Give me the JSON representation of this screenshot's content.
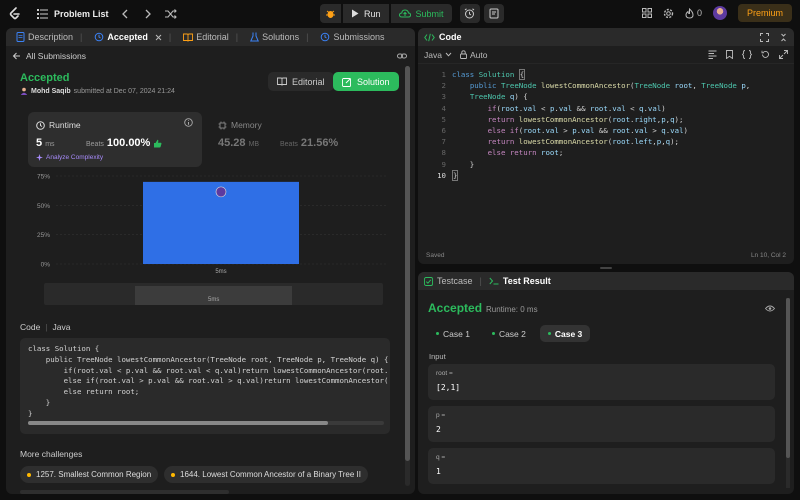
{
  "topbar": {
    "problem_list": "Problem List",
    "run": "Run",
    "submit": "Submit",
    "streak_count": "0",
    "premium": "Premium"
  },
  "left": {
    "tabs": [
      {
        "label": "Description"
      },
      {
        "label": "Accepted"
      },
      {
        "label": "Editorial"
      },
      {
        "label": "Solutions"
      },
      {
        "label": "Submissions"
      }
    ],
    "back_label": "All Submissions",
    "status": "Accepted",
    "author": "Mohd Saqib",
    "submitted_text": "submitted at Dec 07, 2024 21:24",
    "editorial_btn": "Editorial",
    "solution_btn": "Solution",
    "runtime": {
      "label": "Runtime",
      "value": "5",
      "unit": "ms",
      "beats_label": "Beats",
      "beats_value": "100.00%",
      "analyze": "Analyze Complexity"
    },
    "memory": {
      "label": "Memory",
      "value": "45.28",
      "unit": "MB",
      "beats_label": "Beats",
      "beats_value": "21.56%"
    },
    "code_label": "Code",
    "code_lang": "Java",
    "code_snippet": "class Solution {\n    public TreeNode lowestCommonAncestor(TreeNode root, TreeNode p, TreeNode q) {\n        if(root.val < p.val && root.val < q.val)return lowestCommonAncestor(root.\n        else if(root.val > p.val && root.val > q.val)return lowestCommonAncestor(\n        else return root;\n    }\n}",
    "more_title": "More challenges",
    "challenges": [
      {
        "label": "1257. Smallest Common Region"
      },
      {
        "label": "1644. Lowest Common Ancestor of a Binary Tree II"
      }
    ]
  },
  "chart_data": {
    "type": "bar",
    "categories": [
      "5ms"
    ],
    "values": [
      70
    ],
    "yticks": [
      "75%",
      "50%",
      "25%",
      "0%"
    ],
    "ylim": [
      0,
      75
    ],
    "bar_color": "#2f6fe6",
    "grid": true
  },
  "code_panel": {
    "title": "Code",
    "language": "Java",
    "mode": "Auto",
    "saved": "Saved",
    "cursor": "Ln 10, Col 2",
    "line_numbers": [
      "1",
      "2",
      "3",
      "4",
      "5",
      "6",
      "7",
      "8",
      "9",
      "10"
    ]
  },
  "test_panel": {
    "tab_testcase": "Testcase",
    "tab_result": "Test Result",
    "status": "Accepted",
    "runtime": "Runtime: 0 ms",
    "cases": [
      {
        "label": "Case 1"
      },
      {
        "label": "Case 2"
      },
      {
        "label": "Case 3"
      }
    ],
    "input_label": "Input",
    "inputs": [
      {
        "name": "root =",
        "value": "[2,1]"
      },
      {
        "name": "p =",
        "value": "2"
      },
      {
        "name": "q =",
        "value": "1"
      }
    ]
  },
  "colors": {
    "accent_green": "#2cbb5d",
    "premium_orange": "#ffa116",
    "bar_blue": "#2f6fe6"
  }
}
